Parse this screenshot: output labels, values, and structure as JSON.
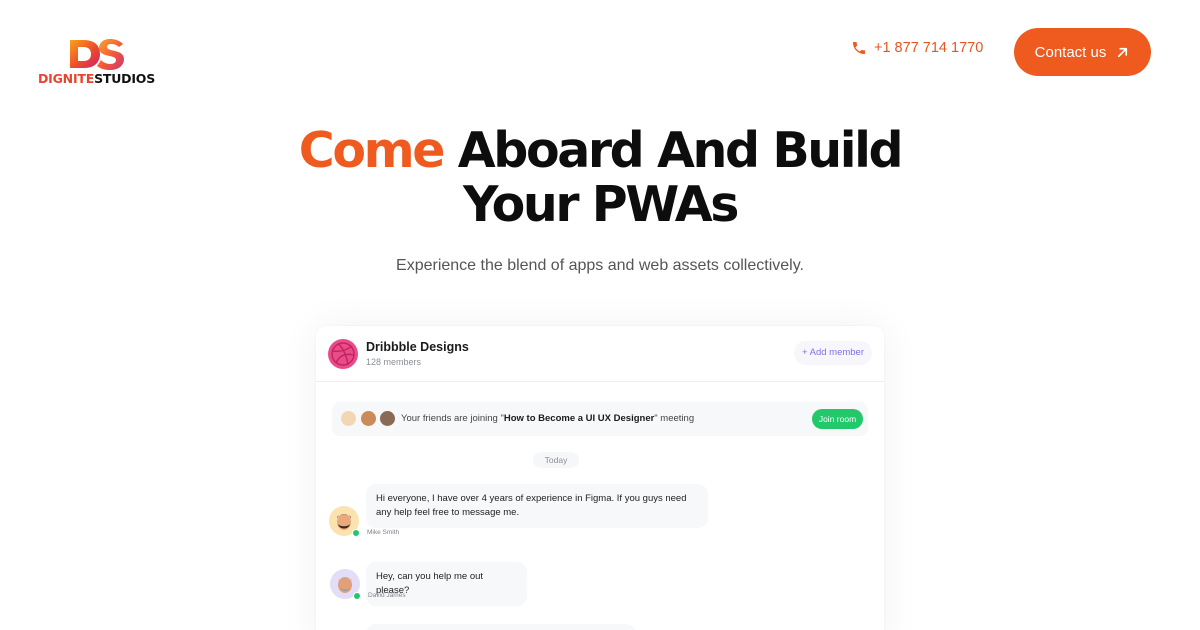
{
  "brand": {
    "logo_text_part1": "DIGNITE",
    "logo_text_part2": "STUDIOS",
    "mark_letters": "DS",
    "accent_color": "#ef5a1f"
  },
  "header": {
    "phone_icon": "phone-icon",
    "phone_number": "+1 877 714 1770",
    "contact_label": "Contact us",
    "contact_icon": "arrow-up-right-icon"
  },
  "hero": {
    "title_accent": "Come",
    "title_rest_line1": "Aboard And Build",
    "title_line2": "Your PWAs",
    "subtitle": "Experience the blend of apps and web assets collectively."
  },
  "chat": {
    "group_icon": "dribbble-icon",
    "group_name": "Dribbble Designs",
    "members": "128 members",
    "add_member_label": "+ Add member",
    "meeting": {
      "text_prefix": "Your friends are joining \"",
      "meeting_title": "How to Become a UI UX Designer",
      "text_suffix": "\" meeting",
      "join_label": "Join room"
    },
    "date_divider": "Today",
    "messages": [
      {
        "line1": "Hi everyone, I have over 4 years of experience in Figma. If you guys need",
        "line2": "any help feel free to message me.",
        "sender": "Mike Smith"
      },
      {
        "line1": "Hey, can you help me out please?",
        "sender": "David James"
      }
    ]
  }
}
